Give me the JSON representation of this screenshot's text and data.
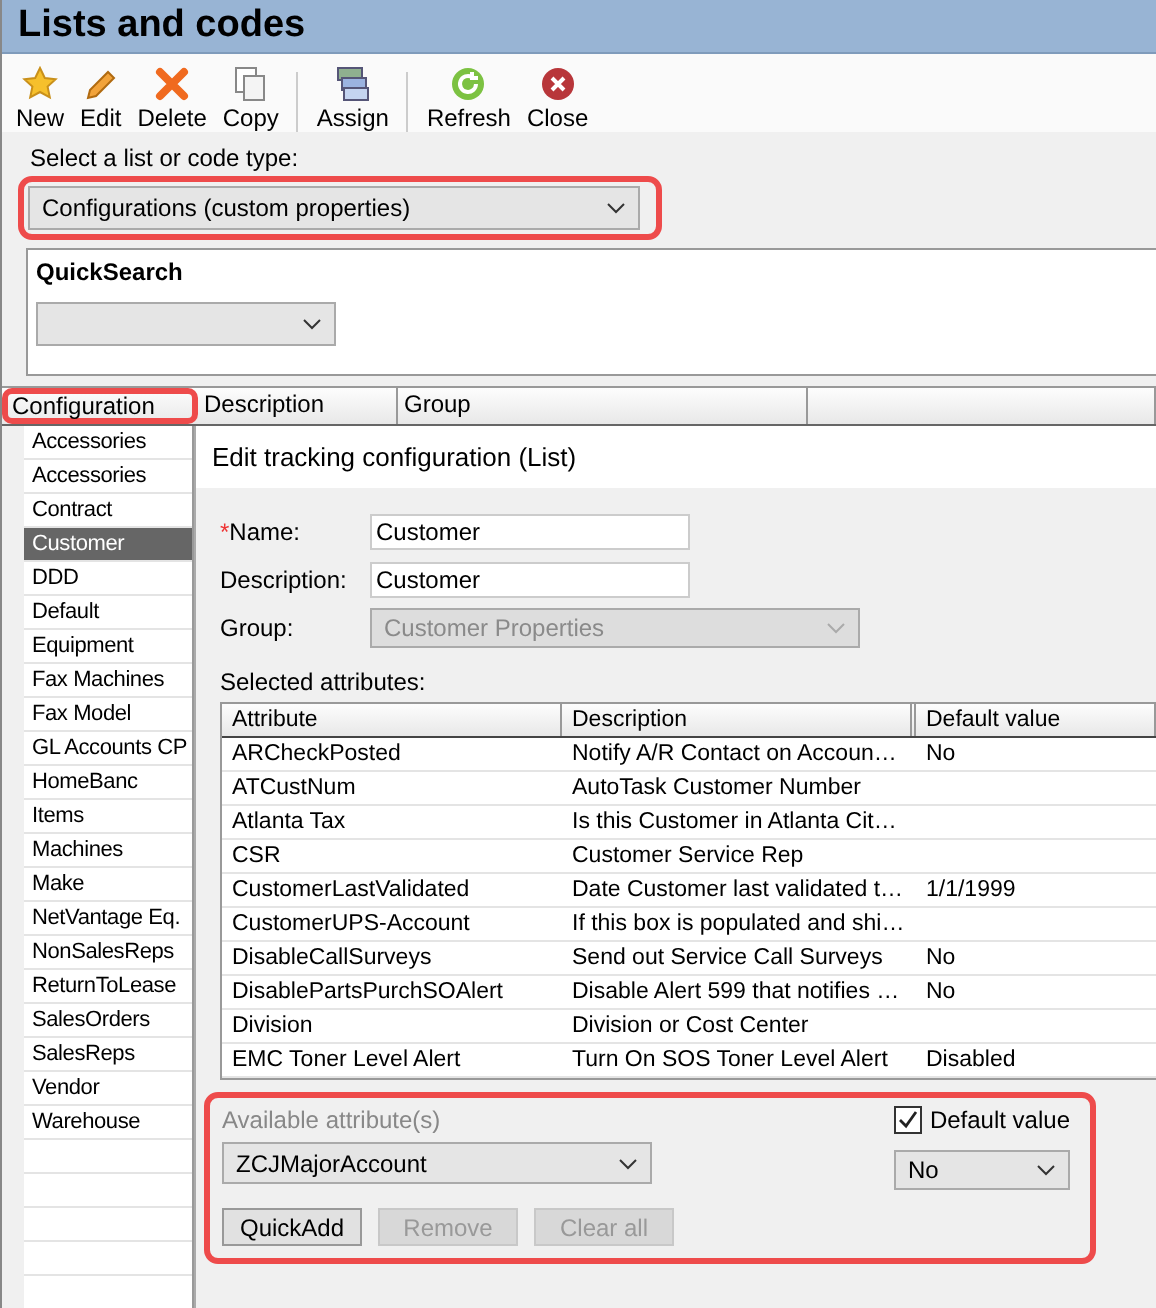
{
  "window": {
    "title": "Lists and codes"
  },
  "toolbar": [
    {
      "label": "New",
      "kind": "star",
      "separator_after": false
    },
    {
      "label": "Edit",
      "kind": "pencil",
      "separator_after": false
    },
    {
      "label": "Delete",
      "kind": "cross",
      "separator_after": false
    },
    {
      "label": "Copy",
      "kind": "copy",
      "separator_after": true
    },
    {
      "label": "Assign",
      "kind": "assign",
      "separator_after": true
    },
    {
      "label": "Refresh",
      "kind": "refresh",
      "separator_after": false
    },
    {
      "label": "Close",
      "kind": "close",
      "separator_after": false
    }
  ],
  "list_type": {
    "label": "Select a list or code type:",
    "value": "Configurations (custom properties)"
  },
  "quicksearch": {
    "label": "QuickSearch"
  },
  "table": {
    "columns": [
      "Configuration",
      "Description",
      "Group"
    ]
  },
  "list": [
    {
      "label": "Accessories",
      "selected": false
    },
    {
      "label": "Accessories",
      "selected": false
    },
    {
      "label": "Contract",
      "selected": false
    },
    {
      "label": "Customer",
      "selected": true
    },
    {
      "label": "DDD",
      "selected": false
    },
    {
      "label": "Default",
      "selected": false
    },
    {
      "label": "Equipment",
      "selected": false
    },
    {
      "label": "Fax Machines",
      "selected": false
    },
    {
      "label": "Fax Model",
      "selected": false
    },
    {
      "label": "GL Accounts CP",
      "selected": false
    },
    {
      "label": "HomeBanc",
      "selected": false
    },
    {
      "label": "Items",
      "selected": false
    },
    {
      "label": "Machines",
      "selected": false
    },
    {
      "label": "Make",
      "selected": false
    },
    {
      "label": "NetVantage Eq.",
      "selected": false
    },
    {
      "label": "NonSalesReps",
      "selected": false
    },
    {
      "label": "ReturnToLease",
      "selected": false
    },
    {
      "label": "SalesOrders",
      "selected": false
    },
    {
      "label": "SalesReps",
      "selected": false
    },
    {
      "label": "Vendor",
      "selected": false
    },
    {
      "label": "Warehouse",
      "selected": false
    }
  ],
  "dialog": {
    "title": "Edit tracking configuration (List)",
    "fields": [
      {
        "label": "Name:",
        "required_mark": "*",
        "value": "Customer",
        "disabled": false,
        "kind": "text"
      },
      {
        "label": "Description:",
        "value": "Customer",
        "disabled": false,
        "kind": "text"
      },
      {
        "label": "Group:",
        "value": "Customer Properties",
        "disabled": true,
        "kind": "select"
      }
    ],
    "selected_label": "Selected attributes:",
    "attribute_columns": [
      "Attribute",
      "Description",
      "Default value"
    ],
    "attributes": [
      {
        "attribute": "ARCheckPosted",
        "description": "Notify A/R Contact on Accoun…",
        "default_value": "No"
      },
      {
        "attribute": "ATCustNum",
        "description": "AutoTask Customer Number"
      },
      {
        "attribute": "Atlanta Tax",
        "description": "Is this Customer in Atlanta Cit…"
      },
      {
        "attribute": "CSR",
        "description": "Customer Service Rep"
      },
      {
        "attribute": "CustomerLastValidated",
        "description": "Date Customer last validated t…",
        "default_value": "1/1/1999"
      },
      {
        "attribute": "CustomerUPS-Account",
        "description": "If this box is populated and shi…"
      },
      {
        "attribute": "DisableCallSurveys",
        "description": "Send out Service Call Surveys",
        "default_value": "No"
      },
      {
        "attribute": "DisablePartsPurchSOAlert",
        "description": "Disable Alert 599 that notifies …",
        "default_value": "No"
      },
      {
        "attribute": "Division",
        "description": "Division or Cost Center"
      },
      {
        "attribute": "EMC Toner Level Alert",
        "description": "Turn On SOS Toner Level Alert",
        "default_value": "Disabled"
      }
    ],
    "available": {
      "label": "Available attribute(s)",
      "value": "ZCJMajorAccount"
    },
    "default_value": {
      "label": "Default value",
      "checked": true,
      "value": "No"
    },
    "buttons": [
      {
        "label": "QuickAdd",
        "disabled": false
      },
      {
        "label": "Remove",
        "disabled": true
      },
      {
        "label": "Clear all",
        "disabled": true
      }
    ]
  }
}
